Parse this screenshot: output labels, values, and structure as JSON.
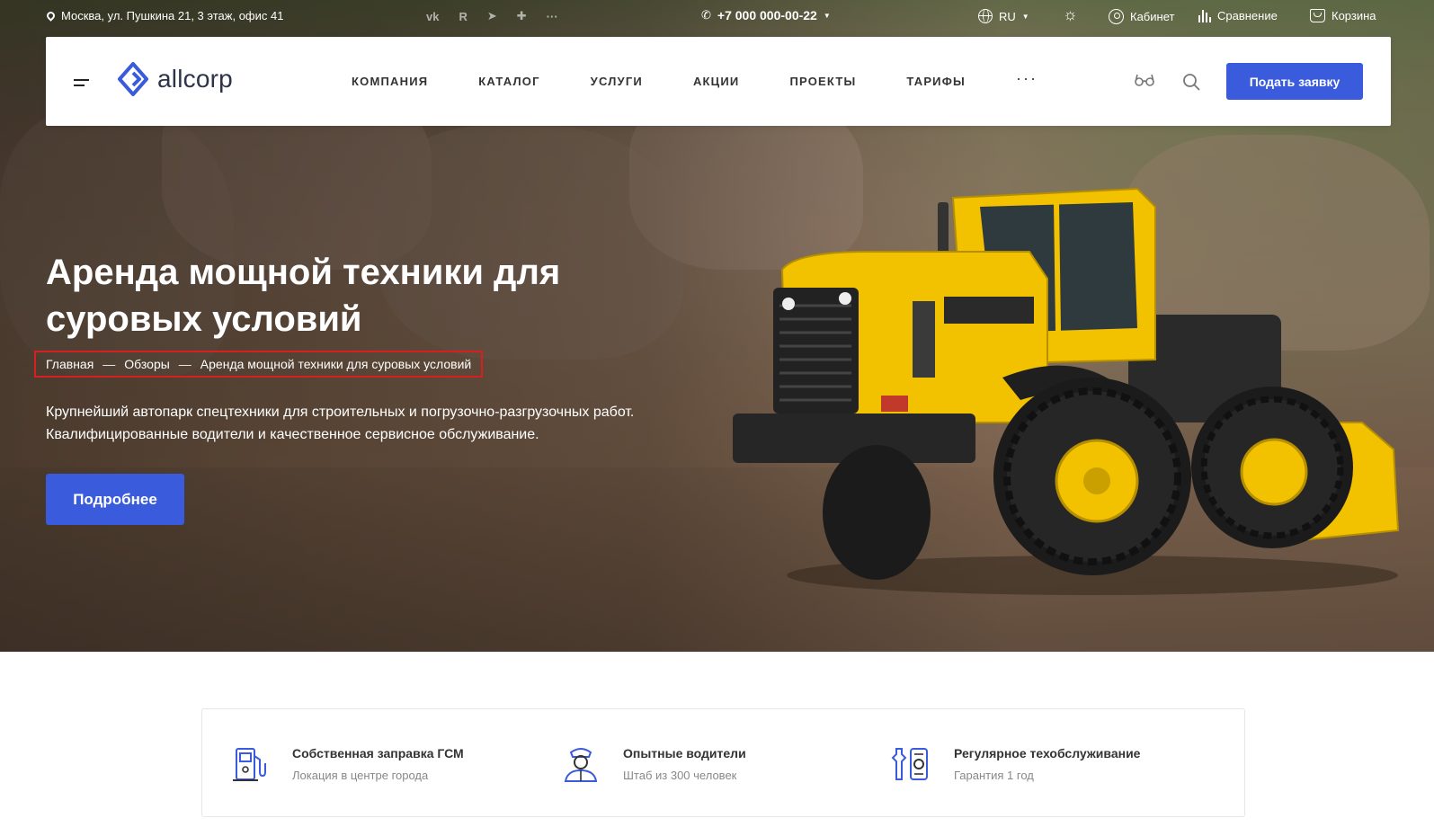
{
  "topbar": {
    "address": "Москва, ул. Пушкина 21, 3 этаж, офис 41",
    "socials": [
      "vk",
      "rutube",
      "telegram",
      "ok"
    ],
    "more": "···",
    "phone": "+7 000 000-00-22",
    "language": "RU",
    "cabinet": "Кабинет",
    "compare": "Сравнение",
    "cart": "Корзина"
  },
  "header": {
    "logo_text": "allcorp",
    "nav": [
      "КОМПАНИЯ",
      "КАТАЛОГ",
      "УСЛУГИ",
      "АКЦИИ",
      "ПРОЕКТЫ",
      "ТАРИФЫ"
    ],
    "nav_more": "···",
    "cta": "Подать заявку"
  },
  "hero": {
    "title": "Аренда мощной техники для суровых условий",
    "breadcrumb": [
      "Главная",
      "Обзоры",
      "Аренда мощной техники для суровых условий"
    ],
    "breadcrumb_separator": "—",
    "description": "Крупнейший автопарк спецтехники для строительных и погрузочно-разгрузочных работ. Квалифицированные водители и качественное сервисное обслуживание.",
    "button": "Подробнее"
  },
  "features": [
    {
      "icon": "fuel-station-icon",
      "title": "Собственная заправка ГСМ",
      "subtitle": "Локация в центре города"
    },
    {
      "icon": "driver-icon",
      "title": "Опытные водители",
      "subtitle": "Штаб из 300 человек"
    },
    {
      "icon": "tools-icon",
      "title": "Регулярное техобслуживание",
      "subtitle": "Гарантия 1 год"
    }
  ],
  "colors": {
    "accent": "#3a5bdc",
    "highlight_border": "#d81e1e",
    "loader_yellow": "#f2c200"
  }
}
